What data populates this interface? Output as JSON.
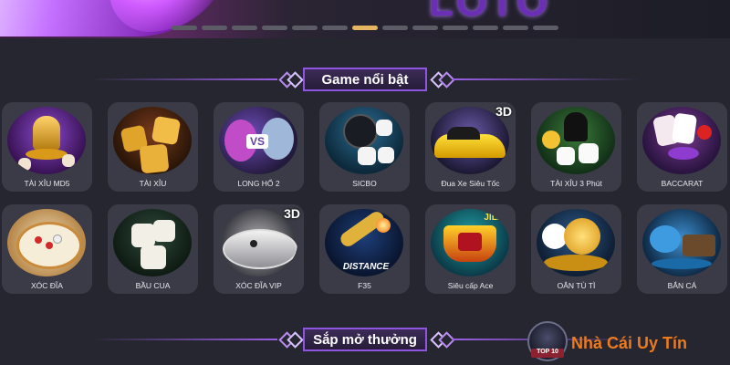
{
  "banner": {
    "logo_text": "LOTO",
    "slides_count": 13,
    "active_slide": 7
  },
  "sections": {
    "featured_title": "Game nổi bật",
    "upcoming_title": "Sắp mở thưởng"
  },
  "games": [
    {
      "label": "TÀI XỈU MD5"
    },
    {
      "label": "TÀI XỈU"
    },
    {
      "label": "LONG HỔ 2"
    },
    {
      "label": "SICBO"
    },
    {
      "label": "Đua Xe Siêu Tốc",
      "badge": "3D"
    },
    {
      "label": "TÀI XỈU 3 Phút"
    },
    {
      "label": "BACCARAT"
    },
    {
      "label": "XÓC ĐĨA"
    },
    {
      "label": "BẦU CUA"
    },
    {
      "label": "XÓC ĐĨA VIP",
      "badge": "3D"
    },
    {
      "label": "F35",
      "art_text": "DISTANCE"
    },
    {
      "label": "Siêu cấp Ace",
      "art_text": "JILI"
    },
    {
      "label": "OẲN TÙ TÌ"
    },
    {
      "label": "BẮN CÁ"
    }
  ],
  "watermark": {
    "seal_text": "TOP 10",
    "brand_text": "Nhà Cái Uy Tín"
  },
  "colors": {
    "accent": "#9a5ee6",
    "active_dot": "#e6b561",
    "brand": "#ee7a1e",
    "card_bg": "#3a3b46",
    "page_bg": "#25262f"
  }
}
